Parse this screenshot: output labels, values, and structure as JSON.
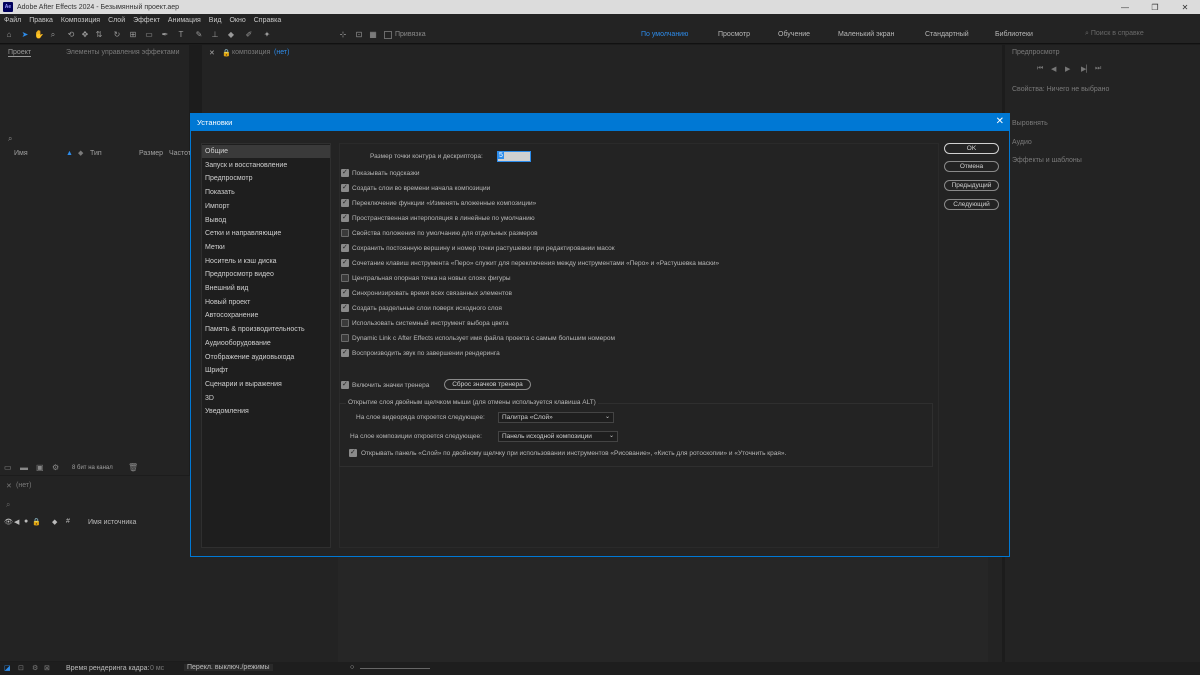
{
  "window": {
    "title": "Adobe After Effects 2024 - Безымянный проект.aep",
    "logo": "Ae"
  },
  "menu": [
    "Файл",
    "Правка",
    "Композиция",
    "Слой",
    "Эффект",
    "Анимация",
    "Вид",
    "Окно",
    "Справка"
  ],
  "toolbar": {
    "snap_label": "Привязка",
    "workspaces": [
      "По умолчанию",
      "Просмотр",
      "Обучение",
      "Маленький экран",
      "Стандартный",
      "Библиотеки"
    ],
    "search_placeholder": "Поиск в справке"
  },
  "project_panel": {
    "tab_project": "Проект",
    "tab_effects": "Элементы управления эффектами",
    "columns": [
      "Имя",
      "Тип",
      "Размер",
      "Частота"
    ],
    "bit_depth": "8 бит на канал"
  },
  "comp_panel": {
    "tab_label": "композиция",
    "tab_value": "(нет)"
  },
  "right_panels": {
    "preview": "Предпросмотр",
    "properties": "Свойства: Ничего не выбрано",
    "align": "Выровнять",
    "audio": "Аудио",
    "effects": "Эффекты и шаблоны"
  },
  "timeline": {
    "tab": "(нет)",
    "source_name": "Имя источника"
  },
  "statusbar": {
    "render_time_label": "Время рендеринга кадра:",
    "render_time_value": "0 мс",
    "toggle_label": "Перекл. выключ./режимы"
  },
  "dialog": {
    "title": "Установки",
    "categories": [
      "Общие",
      "Запуск и восстановление",
      "Предпросмотр",
      "Показать",
      "Импорт",
      "Вывод",
      "Сетки и направляющие",
      "Метки",
      "Носитель и кэш диска",
      "Предпросмотр видео",
      "Внешний вид",
      "Новый проект",
      "Автосохранение",
      "Память & производительность",
      "Аудиооборудование",
      "Отображение аудиовыхода",
      "Шрифт",
      "Сценарии и выражения",
      "3D",
      "Уведомления"
    ],
    "selected_category": "Общие",
    "path_point_label": "Размер точки контура и дескриптора:",
    "path_point_value": "5",
    "options": [
      {
        "label": "Показывать подсказки",
        "checked": true
      },
      {
        "label": "Создать слои во времени начала композиции",
        "checked": true
      },
      {
        "label": "Переключение функции «Изменять вложенные композиции»",
        "checked": true
      },
      {
        "label": "Пространственная интерполяция в линейные по умолчанию",
        "checked": true
      },
      {
        "label": "Свойства положения по умолчанию для отдельных размеров",
        "checked": false
      },
      {
        "label": "Сохранить постоянную вершину и номер точки растушевки при редактировании масок",
        "checked": true
      },
      {
        "label": "Сочетание клавиш инструмента «Перо» служит для переключения между инструментами «Перо» и «Растушевка маски»",
        "checked": true
      },
      {
        "label": "Центральная опорная точка на новых слоях фигуры",
        "checked": false
      },
      {
        "label": "Синхронизировать время всех связанных элементов",
        "checked": true
      },
      {
        "label": "Создать раздельные слои поверх исходного слоя",
        "checked": true
      },
      {
        "label": "Использовать системный инструмент выбора цвета",
        "checked": false
      },
      {
        "label": "Dynamic Link с After Effects использует имя файла проекта с самым большим номером",
        "checked": false
      },
      {
        "label": "Воспроизводить звук по завершении рендеринга",
        "checked": true
      }
    ],
    "coach_label": "Включить значки тренера",
    "coach_checked": true,
    "coach_reset": "Сброс значков тренера",
    "dblclick_group": "Открытие слоя двойным щелчком мыши (для отмены используется клавиша ALT)",
    "footage_label": "На слое видеоряда откроется следующее:",
    "footage_value": "Палитра «Слой»",
    "comp_label": "На слое композиции откроется следующее:",
    "comp_value": "Панель исходной композиции",
    "paint_label": "Открывать панель «Слой» по двойному щелчку при использовании инструментов «Рисование», «Кисть для ротоскопии» и «Уточнить края».",
    "paint_checked": true,
    "buttons": {
      "ok": "OK",
      "cancel": "Отмена",
      "prev": "Предыдущий",
      "next": "Следующий"
    }
  }
}
